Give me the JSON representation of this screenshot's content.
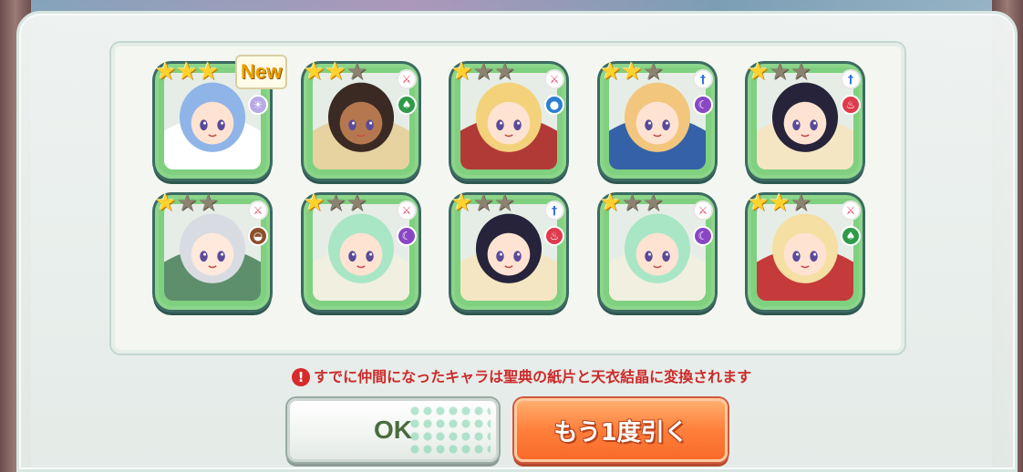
{
  "dialog": {
    "new_label": "New",
    "notice": "すでに仲間になったキャラは聖典の紙片と天衣結晶に変換されます",
    "notice_icon": "!"
  },
  "buttons": {
    "ok_label": "OK",
    "again_label": "もう1度引く"
  },
  "colors": {
    "card_green": "#7fd07f",
    "star_on": "#ffd22e",
    "star_off": "#8b8270",
    "notice_red": "#cc2a2a",
    "again_orange": "#ff7f3a"
  },
  "cards": [
    {
      "stars": 3,
      "role_icon": "none",
      "element_icon": "light-icon",
      "element_color": "#b8a9e6",
      "hair": "#8fb4e8",
      "skin": "#ffe3d2",
      "outfit": "#ffffff",
      "is_new": true
    },
    {
      "stars": 2,
      "role_icon": "sword-icon",
      "element_icon": "tree-icon",
      "element_color": "#2f9b4a",
      "hair": "#3b2a24",
      "skin": "#b5784e",
      "outfit": "#e7d3a0",
      "is_new": false
    },
    {
      "stars": 1,
      "role_icon": "sword-icon",
      "element_icon": "water-icon",
      "element_color": "#2b7fd4",
      "hair": "#f3d27b",
      "skin": "#ffe3d2",
      "outfit": "#b23a36",
      "is_new": false
    },
    {
      "stars": 2,
      "role_icon": "staff-icon",
      "element_icon": "moon-icon",
      "element_color": "#8a47c5",
      "hair": "#f2c67d",
      "skin": "#ffe3d2",
      "outfit": "#3461a7",
      "is_new": false
    },
    {
      "stars": 1,
      "role_icon": "staff-icon",
      "element_icon": "fire-icon",
      "element_color": "#e03a4e",
      "hair": "#26233a",
      "skin": "#ffe3d2",
      "outfit": "#f4e6c2",
      "is_new": false
    },
    {
      "stars": 1,
      "role_icon": "sword-icon",
      "element_icon": "earth-icon",
      "element_color": "#8c4e2c",
      "hair": "#d9dbe2",
      "skin": "#ffe8dc",
      "outfit": "#5d8f6c",
      "is_new": false
    },
    {
      "stars": 1,
      "role_icon": "sword-icon",
      "element_icon": "moon-icon",
      "element_color": "#8a47c5",
      "hair": "#a9e6c5",
      "skin": "#ffe3d2",
      "outfit": "#f0efe0",
      "is_new": false
    },
    {
      "stars": 1,
      "role_icon": "staff-icon",
      "element_icon": "fire-icon",
      "element_color": "#e03a4e",
      "hair": "#26233a",
      "skin": "#ffe3d2",
      "outfit": "#f4e6c2",
      "is_new": false
    },
    {
      "stars": 1,
      "role_icon": "sword-icon",
      "element_icon": "moon-icon",
      "element_color": "#8a47c5",
      "hair": "#a9e6c5",
      "skin": "#ffe3d2",
      "outfit": "#f0efe0",
      "is_new": false
    },
    {
      "stars": 2,
      "role_icon": "sword-icon",
      "element_icon": "tree-icon",
      "element_color": "#2f9b4a",
      "hair": "#f5dfa3",
      "skin": "#ffe3d2",
      "outfit": "#c53a3a",
      "is_new": false
    }
  ]
}
